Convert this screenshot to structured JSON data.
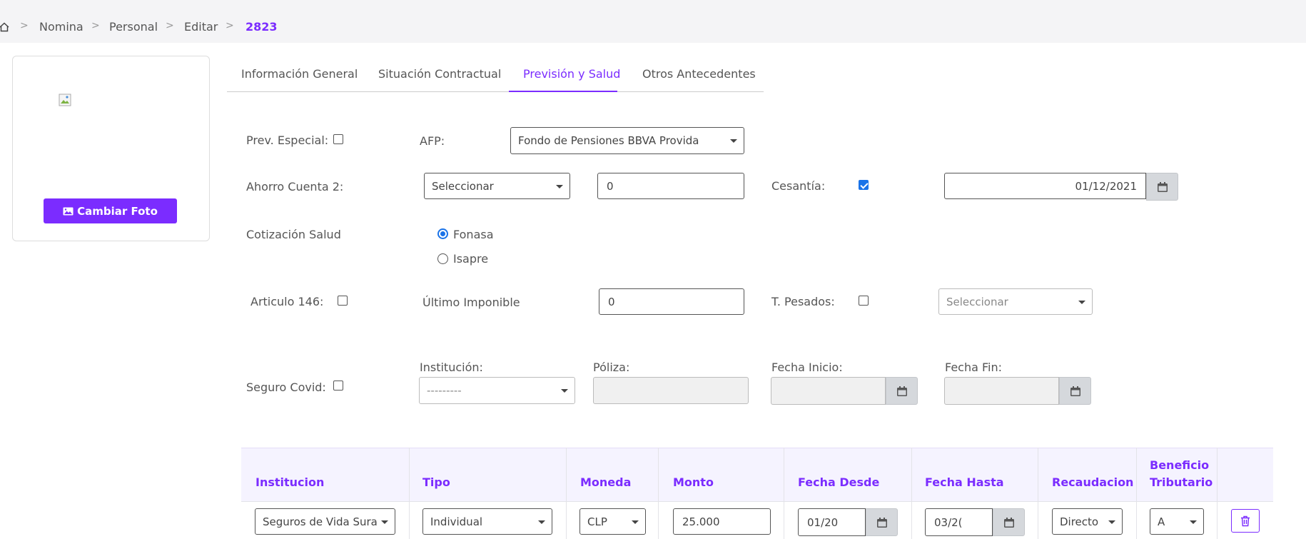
{
  "breadcrumb": {
    "items": [
      "Nomina",
      "Personal",
      "Editar"
    ],
    "current": "2823"
  },
  "photo": {
    "button_label": "Cambiar Foto"
  },
  "tabs": [
    {
      "label": "Información General"
    },
    {
      "label": "Situación Contractual"
    },
    {
      "label": "Previsión y Salud",
      "active": true
    },
    {
      "label": "Otros Antecedentes"
    }
  ],
  "form": {
    "prev_especial_label": "Prev. Especial:",
    "prev_especial_checked": false,
    "afp_label": "AFP:",
    "afp_value": "Fondo de Pensiones BBVA Provida",
    "ahorro_label": "Ahorro Cuenta 2:",
    "ahorro_select": "Seleccionar",
    "ahorro_amount": "0",
    "cesantia_label": "Cesantía:",
    "cesantia_checked": true,
    "cesantia_date": "01/12/2021",
    "cotizacion_label": "Cotización Salud",
    "cotizacion_options": [
      "Fonasa",
      "Isapre"
    ],
    "cotizacion_selected": "Fonasa",
    "articulo_label": "Articulo 146:",
    "articulo_checked": false,
    "ultimo_imponible_label": "Último Imponible",
    "ultimo_imponible_value": "0",
    "t_pesados_label": "T. Pesados:",
    "t_pesados_checked": false,
    "t_pesados_select": "Seleccionar",
    "seguro_covid_label": "Seguro Covid:",
    "seguro_covid_checked": false,
    "institucion_label": "Institución:",
    "institucion_select": "---------",
    "poliza_label": "Póliza:",
    "fecha_inicio_label": "Fecha Inicio:",
    "fecha_fin_label": "Fecha Fin:"
  },
  "table": {
    "headers": [
      "Institucion",
      "Tipo",
      "Moneda",
      "Monto",
      "Fecha Desde",
      "Fecha Hasta",
      "Recaudacion",
      "Beneficio Tributario"
    ],
    "row": {
      "institucion": "Seguros de Vida Sura",
      "tipo": "Individual",
      "moneda": "CLP",
      "monto": "25.000",
      "fecha_desde": "01/20",
      "fecha_hasta": "03/2(",
      "recaudacion": "Directo",
      "beneficio": "A"
    }
  },
  "icons": {
    "home": "home-icon",
    "image": "image-icon",
    "calendar": "calendar-icon",
    "trash": "trash-icon"
  },
  "colors": {
    "accent": "#7b2cff",
    "checkbox_blue": "#1a73e8",
    "table_head_bg": "#f5f3ff"
  }
}
